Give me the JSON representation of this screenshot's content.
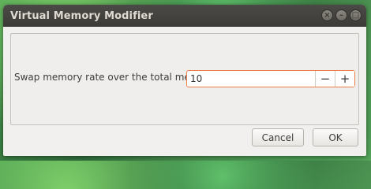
{
  "window": {
    "title": "Virtual Memory Modifier",
    "controls": {
      "close_glyph": "×",
      "minimize_glyph": "–",
      "maximize_glyph": "□"
    }
  },
  "form": {
    "label": "Swap memory rate over the total memory:",
    "value": "10",
    "decrement_glyph": "−",
    "increment_glyph": "+"
  },
  "buttons": {
    "cancel_label": "Cancel",
    "ok_label": "OK"
  },
  "colors": {
    "titlebar": "#3c3b37",
    "focus_border": "#e87e45"
  }
}
